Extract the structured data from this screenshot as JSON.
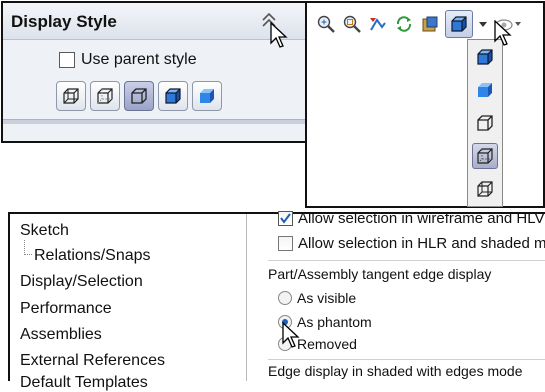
{
  "display_style_panel": {
    "title": "Display Style",
    "checkbox_label": "Use parent style",
    "checkbox_checked": false,
    "selected_style_index": 2,
    "style_icons": [
      "wireframe-icon",
      "hidden-lines-visible-icon",
      "hidden-lines-removed-icon",
      "shaded-with-edges-icon",
      "shaded-icon"
    ]
  },
  "view_toolbar": {
    "icons": [
      "zoom-to-fit-icon",
      "zoom-to-area-icon",
      "previous-view-icon",
      "section-view-icon",
      "view-orientation-icon",
      "display-style-icon",
      "hide-show-items-icon"
    ],
    "dropdown_items": [
      "shaded-with-edges-icon",
      "shaded-icon",
      "hidden-lines-removed-icon",
      "hidden-lines-visible-icon",
      "wireframe-icon"
    ],
    "highlighted_index": 3
  },
  "options_panel": {
    "tree_items": [
      {
        "label": "Sketch",
        "child": false
      },
      {
        "label": "Relations/Snaps",
        "child": true
      },
      {
        "label": "Display/Selection",
        "child": false
      },
      {
        "label": "Performance",
        "child": false
      },
      {
        "label": "Assemblies",
        "child": false
      },
      {
        "label": "External References",
        "child": false
      },
      {
        "label": "Default Templates",
        "child": false
      }
    ],
    "option1_label": "Allow selection in wireframe and HLV",
    "option1_checked": true,
    "option2_label": "Allow selection in HLR and shaded mo",
    "option2_checked": false,
    "group1_label": "Part/Assembly tangent edge display",
    "radio_options": [
      "As visible",
      "As phantom",
      "Removed"
    ],
    "radio_selected_index": 1,
    "group2_label": "Edge display in shaded with edges mode"
  },
  "colors": {
    "accent_blue": "#1f5fb8",
    "panel_header": "#dde3ec",
    "highlight": "#a7aec9"
  }
}
